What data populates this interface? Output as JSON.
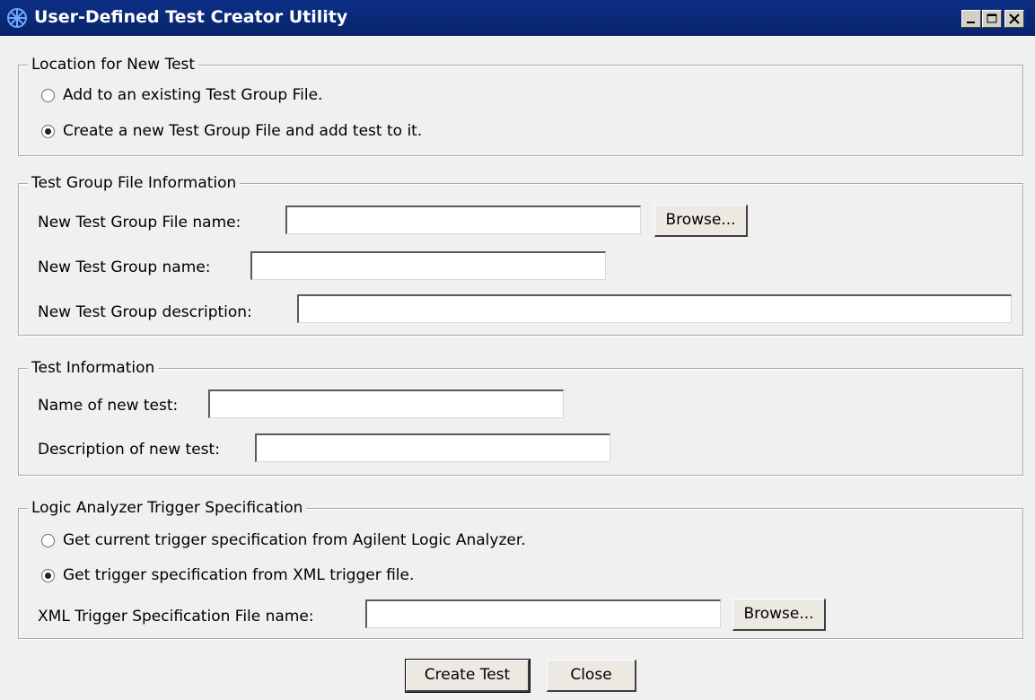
{
  "window": {
    "title": "User-Defined Test Creator Utility",
    "icon": "app-icon",
    "controls": [
      "minimize-icon",
      "maximize-icon",
      "close-icon"
    ]
  },
  "location_group": {
    "legend": "Location for New Test",
    "options": [
      {
        "label": "Add to an existing Test Group File.",
        "checked": false
      },
      {
        "label": "Create a new Test Group File and add test to it.",
        "checked": true
      }
    ]
  },
  "test_group_file_info": {
    "legend": "Test Group File Information",
    "file_name_label": "New Test Group File name:",
    "file_name_value": "",
    "browse_label": "Browse...",
    "group_name_label": "New Test Group name:",
    "group_name_value": "",
    "group_description_label": "New Test Group description:",
    "group_description_value": ""
  },
  "test_info": {
    "legend": "Test Information",
    "test_name_label": "Name of new test:",
    "test_name_value": "",
    "test_description_label": "Description of new test:",
    "test_description_value": ""
  },
  "trigger_spec": {
    "legend": "Logic Analyzer Trigger Specification",
    "options": [
      {
        "label": "Get current trigger specification from Agilent Logic Analyzer.",
        "checked": false
      },
      {
        "label": "Get trigger specification from XML trigger file.",
        "checked": true
      }
    ],
    "xml_file_label": "XML Trigger Specification File name:",
    "xml_file_value": "",
    "browse_label": "Browse..."
  },
  "footer": {
    "create_label": "Create Test",
    "close_label": "Close"
  },
  "colors": {
    "titlebar": "#0a2a7a",
    "background": "#f0f0f0"
  }
}
